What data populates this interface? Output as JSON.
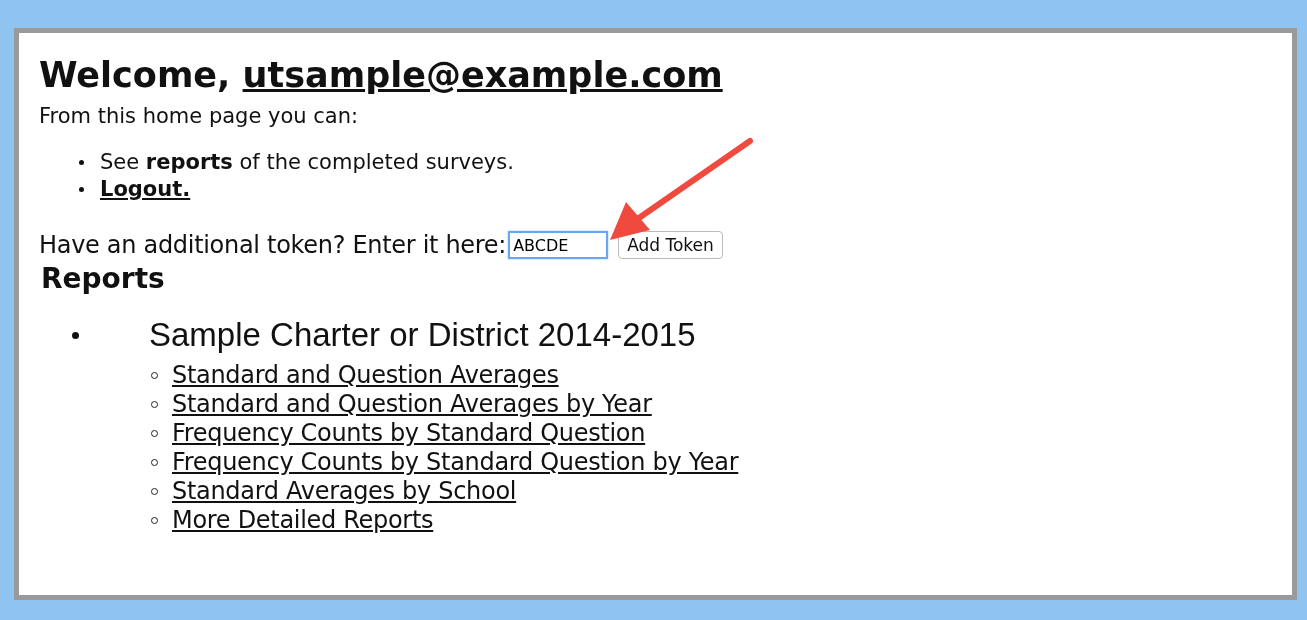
{
  "heading": {
    "prefix": "Welcome, ",
    "email": "utsample@example.com"
  },
  "intro": "From this home page you can:",
  "actions": [
    {
      "kind": "text",
      "text": "See **reports** of the completed surveys."
    },
    {
      "kind": "link",
      "text": "Logout."
    }
  ],
  "token": {
    "label": "Have an additional token? Enter it here:",
    "value": "ABCDE",
    "focused": true,
    "button": "Add Token"
  },
  "reports": {
    "title": "Reports",
    "groups": [
      {
        "name": "Sample Charter or District 2014-2015",
        "links": [
          "Standard and Question Averages",
          "Standard and Question Averages by Year",
          "Frequency Counts by Standard Question",
          "Frequency Counts by Standard Question by Year",
          "Standard Averages by School",
          "More Detailed Reports"
        ]
      }
    ]
  }
}
